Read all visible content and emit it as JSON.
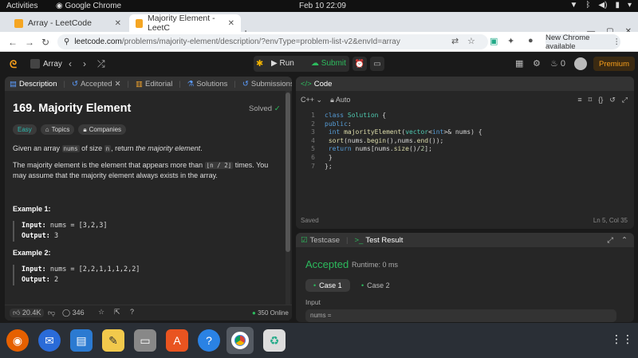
{
  "os": {
    "activities": "Activities",
    "app_name": "Google Chrome",
    "clock": "Feb 10  22:09"
  },
  "browser": {
    "tabs": [
      {
        "title": "Array - LeetCode"
      },
      {
        "title": "Majority Element - LeetC"
      }
    ],
    "url_host": "leetcode.com",
    "url_path": "/problems/majority-element/description/?envType=problem-list-v2&envId=array",
    "new_chrome": "New Chrome available"
  },
  "lc_nav": {
    "list_label": "Array",
    "run": "Run",
    "submit": "Submit",
    "streak": "0",
    "premium": "Premium"
  },
  "left_tabs": [
    "Description",
    "Accepted",
    "Editorial",
    "Solutions",
    "Submissions"
  ],
  "problem": {
    "title": "169. Majority Element",
    "status": "Solved",
    "chips": [
      "Easy",
      "Topics",
      "Companies"
    ],
    "desc1_a": "Given an array ",
    "desc1_code1": "nums",
    "desc1_b": " of size ",
    "desc1_code2": "n",
    "desc1_c": ", return ",
    "desc1_em": "the majority element",
    "desc1_d": ".",
    "desc2_a": "The majority element is the element that appears more than ",
    "desc2_code": "⌊n / 2⌋",
    "desc2_b": " times. You may assume that the majority element always exists in the array.",
    "examples": [
      {
        "title": "Example 1:",
        "input_label": "Input:",
        "input": "nums = [3,2,3]",
        "output_label": "Output:",
        "output": "3"
      },
      {
        "title": "Example 2:",
        "input_label": "Input:",
        "input": "nums = [2,2,1,1,1,2,2]",
        "output_label": "Output:",
        "output": "2"
      }
    ],
    "likes": "20.4K",
    "comments": "346",
    "online": "350 Online"
  },
  "code": {
    "tab": "Code",
    "language": "C++",
    "mode": "Auto",
    "saved": "Saved",
    "cursor": "Ln 5, Col 35"
  },
  "test": {
    "tab_testcase": "Testcase",
    "tab_result": "Test Result",
    "verdict": "Accepted",
    "runtime": "Runtime: 0 ms",
    "cases": [
      "Case 1",
      "Case 2"
    ],
    "input_label": "Input",
    "input_value": "nums ="
  }
}
